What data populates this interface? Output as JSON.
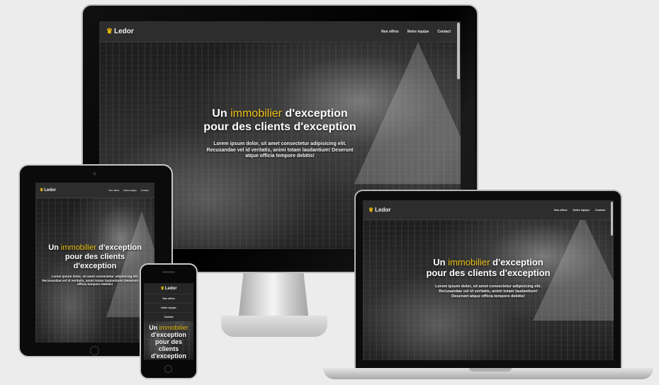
{
  "site": {
    "brand": "Ledor",
    "brand_icon": "crown-icon",
    "nav": [
      "Nos offres",
      "Notre équipe",
      "Contact"
    ],
    "hero": {
      "title_part1": "Un ",
      "title_highlight": "immobilier",
      "title_part2": " d'exception pour des clients d'exception",
      "text": "Lorem ipsum dolor, sit amet consectetur adipisicing elit. Recusandae vel id veritatis, animi totam laudantium! Deserunt atque officia tempore debitis!"
    }
  },
  "colors": {
    "accent": "#f0c419",
    "navbar": "#2d2d2d",
    "background": "#ececec"
  }
}
